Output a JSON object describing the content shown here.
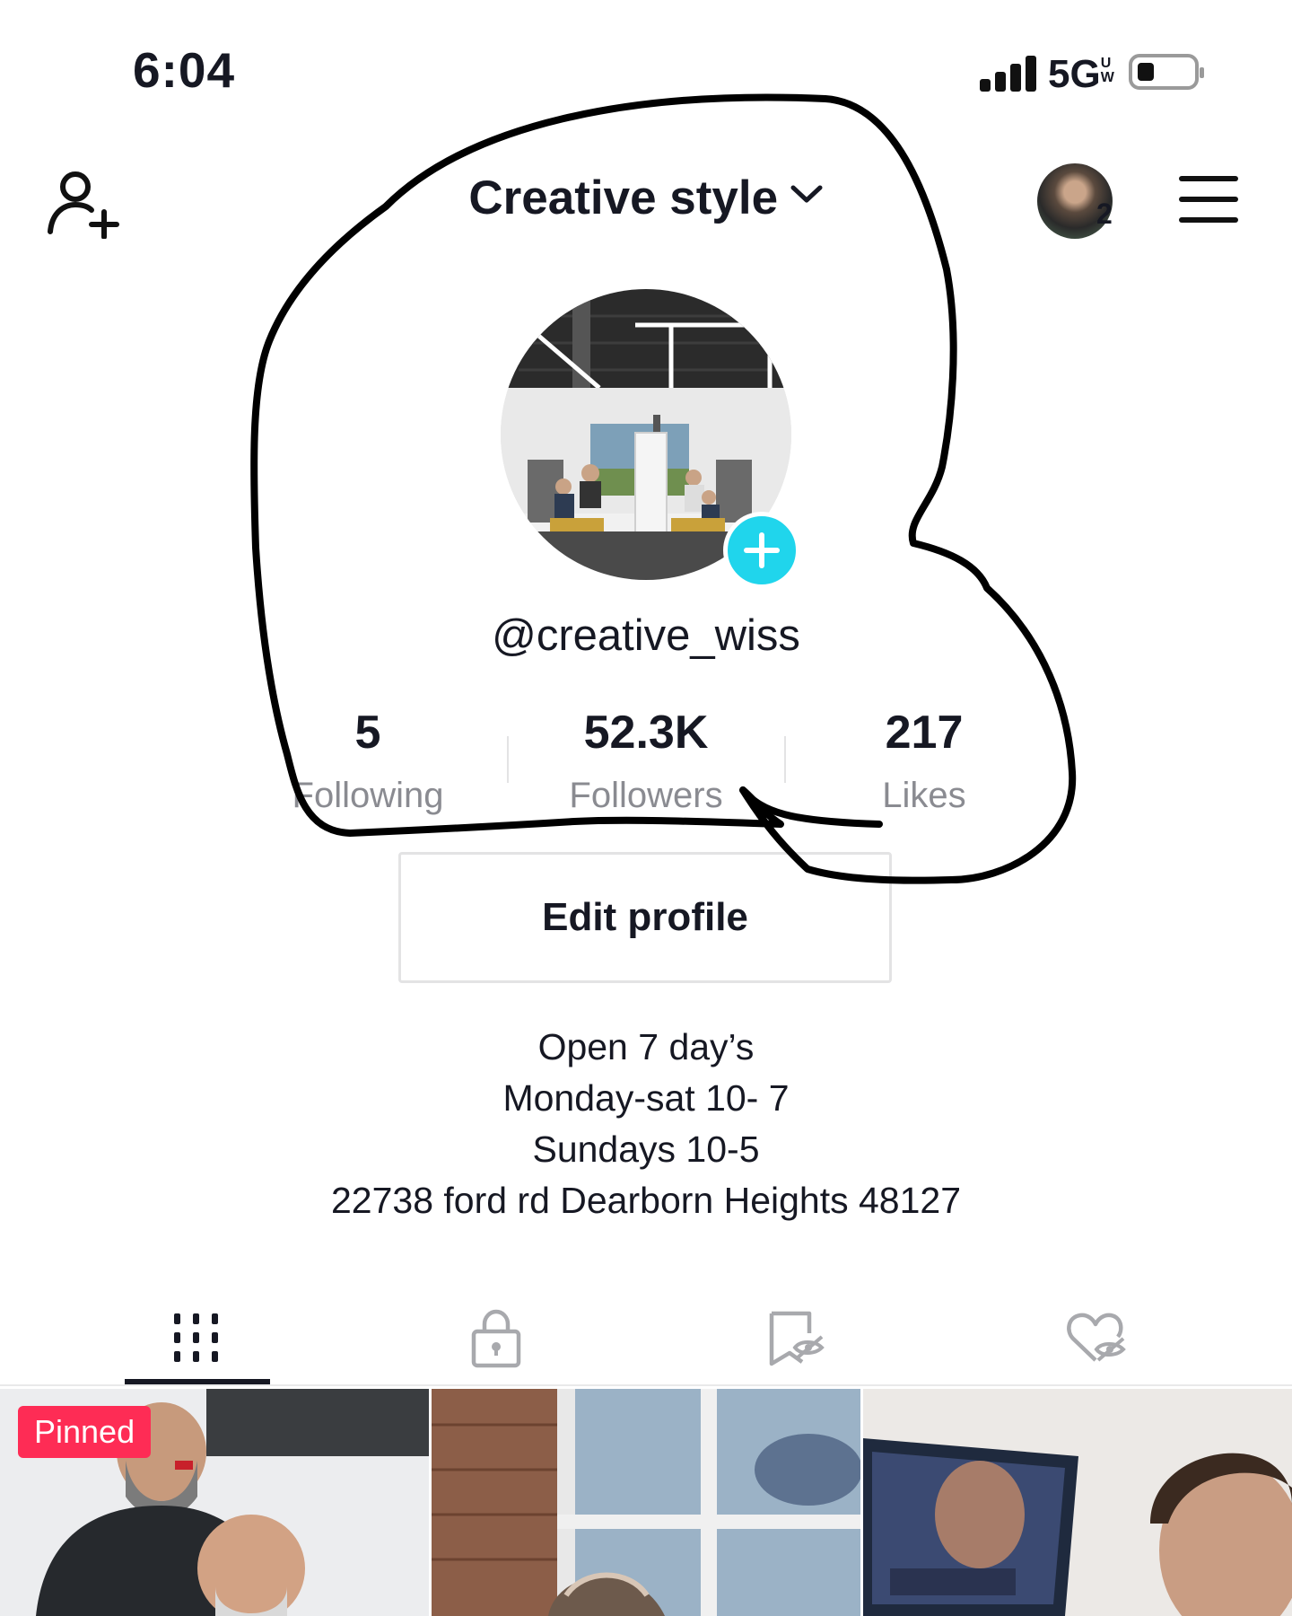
{
  "status_bar": {
    "time": "6:04",
    "network": "5G",
    "network_suffix": "UW"
  },
  "header": {
    "title": "Creative style",
    "account_badge_count": "2"
  },
  "profile": {
    "username": "@creative_wiss",
    "stats": [
      {
        "value": "5",
        "label": "Following"
      },
      {
        "value": "52.3K",
        "label": "Followers"
      },
      {
        "value": "217",
        "label": "Likes"
      }
    ],
    "edit_button_label": "Edit profile",
    "bio_lines": [
      "Open 7 day’s",
      "Monday-sat 10- 7",
      "Sundays 10-5",
      "22738 ford rd Dearborn Heights 48127"
    ]
  },
  "tabs": [
    {
      "icon": "videos-grid-icon",
      "active": true
    },
    {
      "icon": "lock-icon",
      "active": false
    },
    {
      "icon": "bookmark-hidden-icon",
      "active": false
    },
    {
      "icon": "heart-hidden-icon",
      "active": false
    }
  ],
  "grid": {
    "pinned_label": "Pinned"
  },
  "colors": {
    "accent_cyan": "#20d5ec",
    "pinned_red": "#fe2c55",
    "text_primary": "#161823",
    "text_secondary": "#8a8b91"
  }
}
